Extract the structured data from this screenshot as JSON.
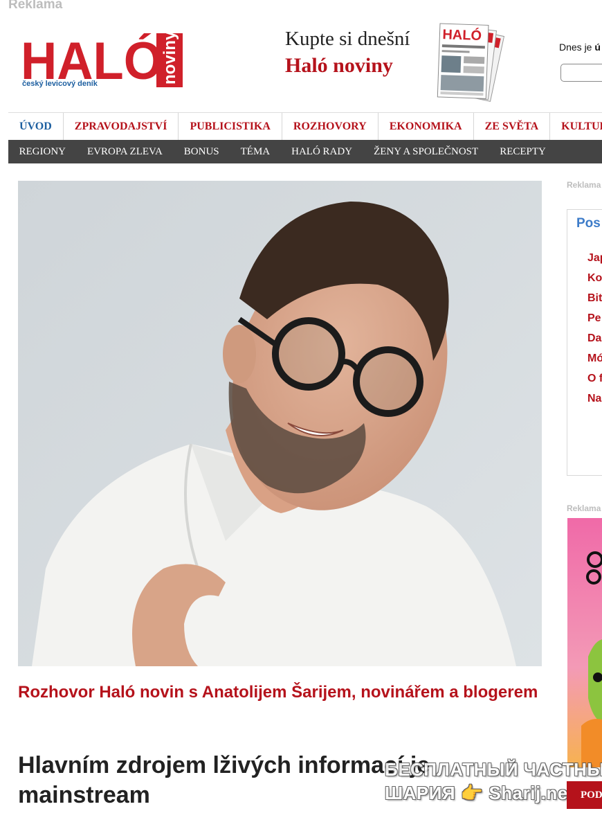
{
  "top_ad_label": "Reklama",
  "logo": {
    "main": "HALÓ",
    "side": "noviny",
    "tagline": "český levicový deník"
  },
  "promo": {
    "line1": "Kupte si dnešní",
    "line2": "Haló noviny",
    "paper_mini_title": "HALÓ"
  },
  "date": {
    "label": "Dnes je ",
    "label_bold": "ú"
  },
  "nav_primary": [
    {
      "label": "ÚVOD",
      "active": true
    },
    {
      "label": "ZPRAVODAJSTVÍ"
    },
    {
      "label": "PUBLICISTIKA"
    },
    {
      "label": "ROZHOVORY"
    },
    {
      "label": "EKONOMIKA"
    },
    {
      "label": "ZE SVĚTA"
    },
    {
      "label": "KULTURA"
    }
  ],
  "nav_secondary": [
    {
      "label": "REGIONY"
    },
    {
      "label": "EVROPA ZLEVA"
    },
    {
      "label": "BONUS"
    },
    {
      "label": "TÉMA"
    },
    {
      "label": "HALÓ RADY"
    },
    {
      "label": "ŽENY A SPOLEČNOST"
    },
    {
      "label": "RECEPTY"
    }
  ],
  "article": {
    "subtitle": "Rozhovor Haló novin s Anatolijem Šarijem, novinářem a blogerem",
    "headline": "Hlavním zdrojem lživých informací je mainstream"
  },
  "sidebar": {
    "ad_label_1": "Reklama",
    "box_title": "Pos",
    "items": [
      {
        "label": "Jap žer"
      },
      {
        "label": "Ko"
      },
      {
        "label": "Bit"
      },
      {
        "label": "Pe př"
      },
      {
        "label": "Da"
      },
      {
        "label": "Mó vo"
      },
      {
        "label": "O f"
      },
      {
        "label": "Na zd"
      }
    ],
    "ad_label_2": "Reklama",
    "podcast_label": "POD"
  },
  "watermark": {
    "line1": "БЕСПЛАТНЫЙ ЧАСТНЫЙ",
    "line2": "ШАРИЯ 👉 Sharij.net"
  },
  "colors": {
    "brand_red": "#b5121b",
    "nav_active_blue": "#1d5fa0",
    "subnav_bg": "#444444",
    "side_title_blue": "#3d7cc9"
  }
}
